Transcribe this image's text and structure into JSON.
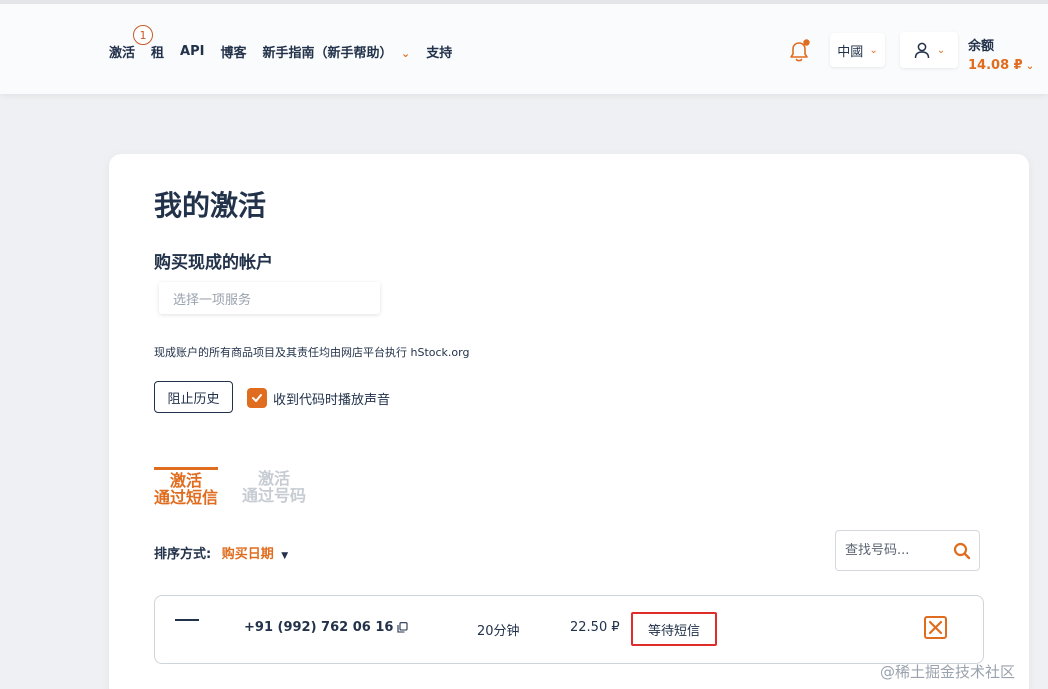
{
  "nav": {
    "items": [
      {
        "label": "激活",
        "badge": "1"
      },
      {
        "label": "租"
      },
      {
        "label": "API"
      },
      {
        "label": "博客"
      },
      {
        "label": "新手指南（新手帮助）"
      },
      {
        "label": "支持"
      }
    ]
  },
  "header": {
    "language": "中國",
    "balance_label": "余额",
    "balance_value": "14.08 ₽"
  },
  "main": {
    "title": "我的激活",
    "section_title": "购买现成的帐户",
    "service_placeholder": "选择一项服务",
    "notice": "现成账户的所有商品项目及其责任均由网店平台执行 hStock.org",
    "history_button": "阻止历史",
    "sound_checkbox_label": "收到代码时播放声音",
    "sound_checked": true,
    "tabs": [
      {
        "line1": "激活",
        "line2": "通过短信",
        "active": true
      },
      {
        "line1": "激活",
        "line2": "通过号码",
        "active": false
      }
    ],
    "sort_label": "排序方式:",
    "sort_value": "购买日期",
    "search_placeholder": "查找号码..."
  },
  "activations": [
    {
      "phone": "+91 (992) 762 06 16",
      "duration": "20分钟",
      "price": "22.50 ₽",
      "status": "等待短信"
    }
  ],
  "watermark": "@稀土掘金技术社区",
  "colors": {
    "accent": "#e06d1f",
    "text": "#22324a",
    "status_border": "#e12c2c"
  }
}
